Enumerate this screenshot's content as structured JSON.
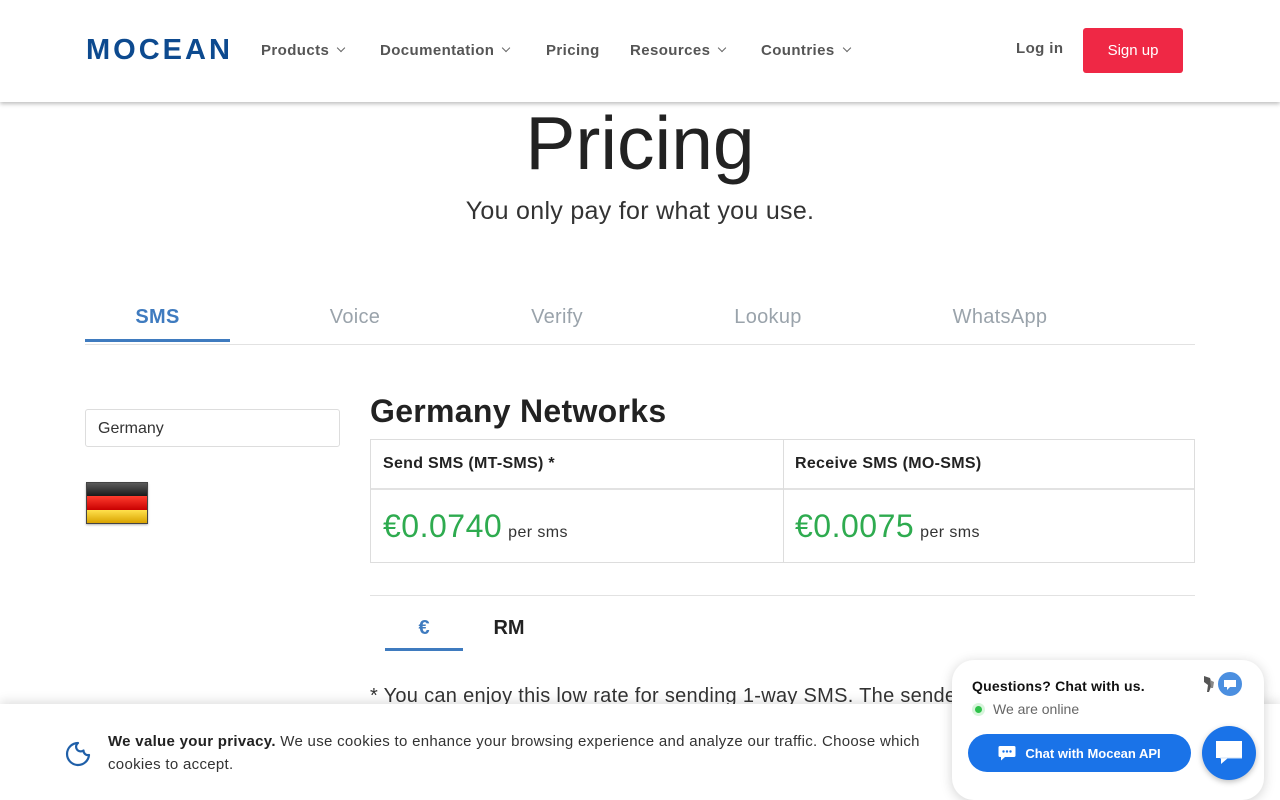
{
  "header": {
    "logo": "MOCEAN",
    "nav": [
      {
        "label": "Products",
        "dropdown": true
      },
      {
        "label": "Documentation",
        "dropdown": true
      },
      {
        "label": "Pricing",
        "dropdown": false
      },
      {
        "label": "Resources",
        "dropdown": true
      },
      {
        "label": "Countries",
        "dropdown": true
      }
    ],
    "login_label": "Log in",
    "signup_label": "Sign up"
  },
  "hero": {
    "title": "Pricing",
    "subtitle": "You only pay for what you use."
  },
  "product_tabs": [
    {
      "label": "SMS",
      "active": true
    },
    {
      "label": "Voice",
      "active": false
    },
    {
      "label": "Verify",
      "active": false
    },
    {
      "label": "Lookup",
      "active": false
    },
    {
      "label": "WhatsApp",
      "active": false
    }
  ],
  "country": {
    "selected": "Germany",
    "flag_icon": "germany-flag-icon"
  },
  "networks": {
    "title": "Germany Networks",
    "columns": [
      {
        "header": "Send SMS (MT-SMS) *",
        "price": "€0.0740",
        "unit": "per sms"
      },
      {
        "header": "Receive SMS (MO-SMS)",
        "price": "€0.0075",
        "unit": "per sms"
      }
    ]
  },
  "currency_tabs": [
    {
      "label": "€",
      "active": true
    },
    {
      "label": "RM",
      "active": false
    }
  ],
  "footnote": "* You can enjoy this low rate for sending 1-way SMS. The sender",
  "cookie_banner": {
    "heading": "We value your privacy.",
    "text": "We use cookies to enhance your browsing experience and analyze our traffic. Choose which cookies to accept."
  },
  "chat_widget": {
    "question": "Questions? Chat with us.",
    "status": "We are online",
    "button_label": "Chat with Mocean API"
  },
  "colors": {
    "brand": "#0d4a8f",
    "signup": "#ef2845",
    "accent": "#3f7bbf",
    "price": "#2eab4f",
    "chat": "#1a73e8"
  }
}
